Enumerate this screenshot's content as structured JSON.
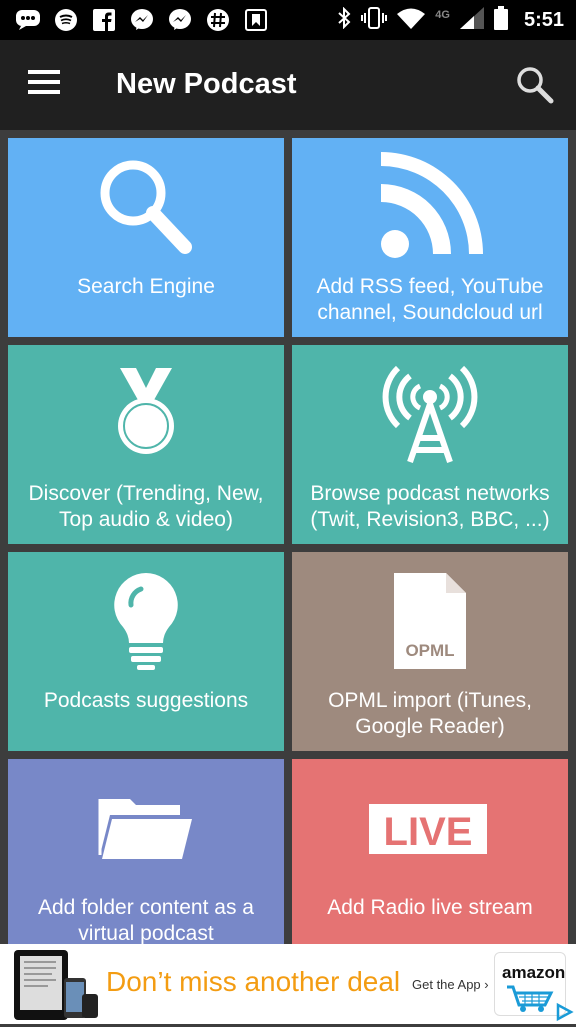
{
  "status_bar": {
    "time": "5:51",
    "network": "4G",
    "icons": [
      "message-icon",
      "spotify-icon",
      "facebook-icon",
      "messenger-icon",
      "messenger-icon",
      "slack-icon",
      "bookmark-app-icon"
    ],
    "system_icons": [
      "bluetooth-icon",
      "vibrate-icon",
      "wifi-icon",
      "signal-icon",
      "battery-icon"
    ]
  },
  "app_bar": {
    "title": "New Podcast",
    "menu_icon": "hamburger-menu-icon",
    "search_icon": "search-icon"
  },
  "tiles": [
    {
      "label": "Search Engine",
      "color": "#62b1f4",
      "icon": "magnifier-icon"
    },
    {
      "label": "Add RSS feed, YouTube channel, Soundcloud url",
      "color": "#62b1f4",
      "icon": "rss-icon"
    },
    {
      "label": "Discover (Trending, New, Top audio & video)",
      "color": "#4fb5aa",
      "icon": "medal-icon"
    },
    {
      "label": "Browse podcast networks (Twit, Revision3, BBC, ...)",
      "color": "#4fb5aa",
      "icon": "antenna-tower-icon"
    },
    {
      "label": "Podcasts suggestions",
      "color": "#4fb5aa",
      "icon": "lightbulb-icon"
    },
    {
      "label": "OPML import (iTunes, Google Reader)",
      "color": "#9e8a7e",
      "icon": "opml-file-icon",
      "icon_text": "OPML"
    },
    {
      "label": "Add folder content as a virtual podcast",
      "color": "#7888c8",
      "icon": "folder-icon"
    },
    {
      "label": "Add Radio live stream",
      "color": "#e57373",
      "icon": "live-badge-icon",
      "icon_text": "LIVE"
    }
  ],
  "ad": {
    "headline": "Don’t miss another deal",
    "cta": "Get the App ›",
    "brand": "amazon",
    "headline_color": "#f39c12"
  }
}
